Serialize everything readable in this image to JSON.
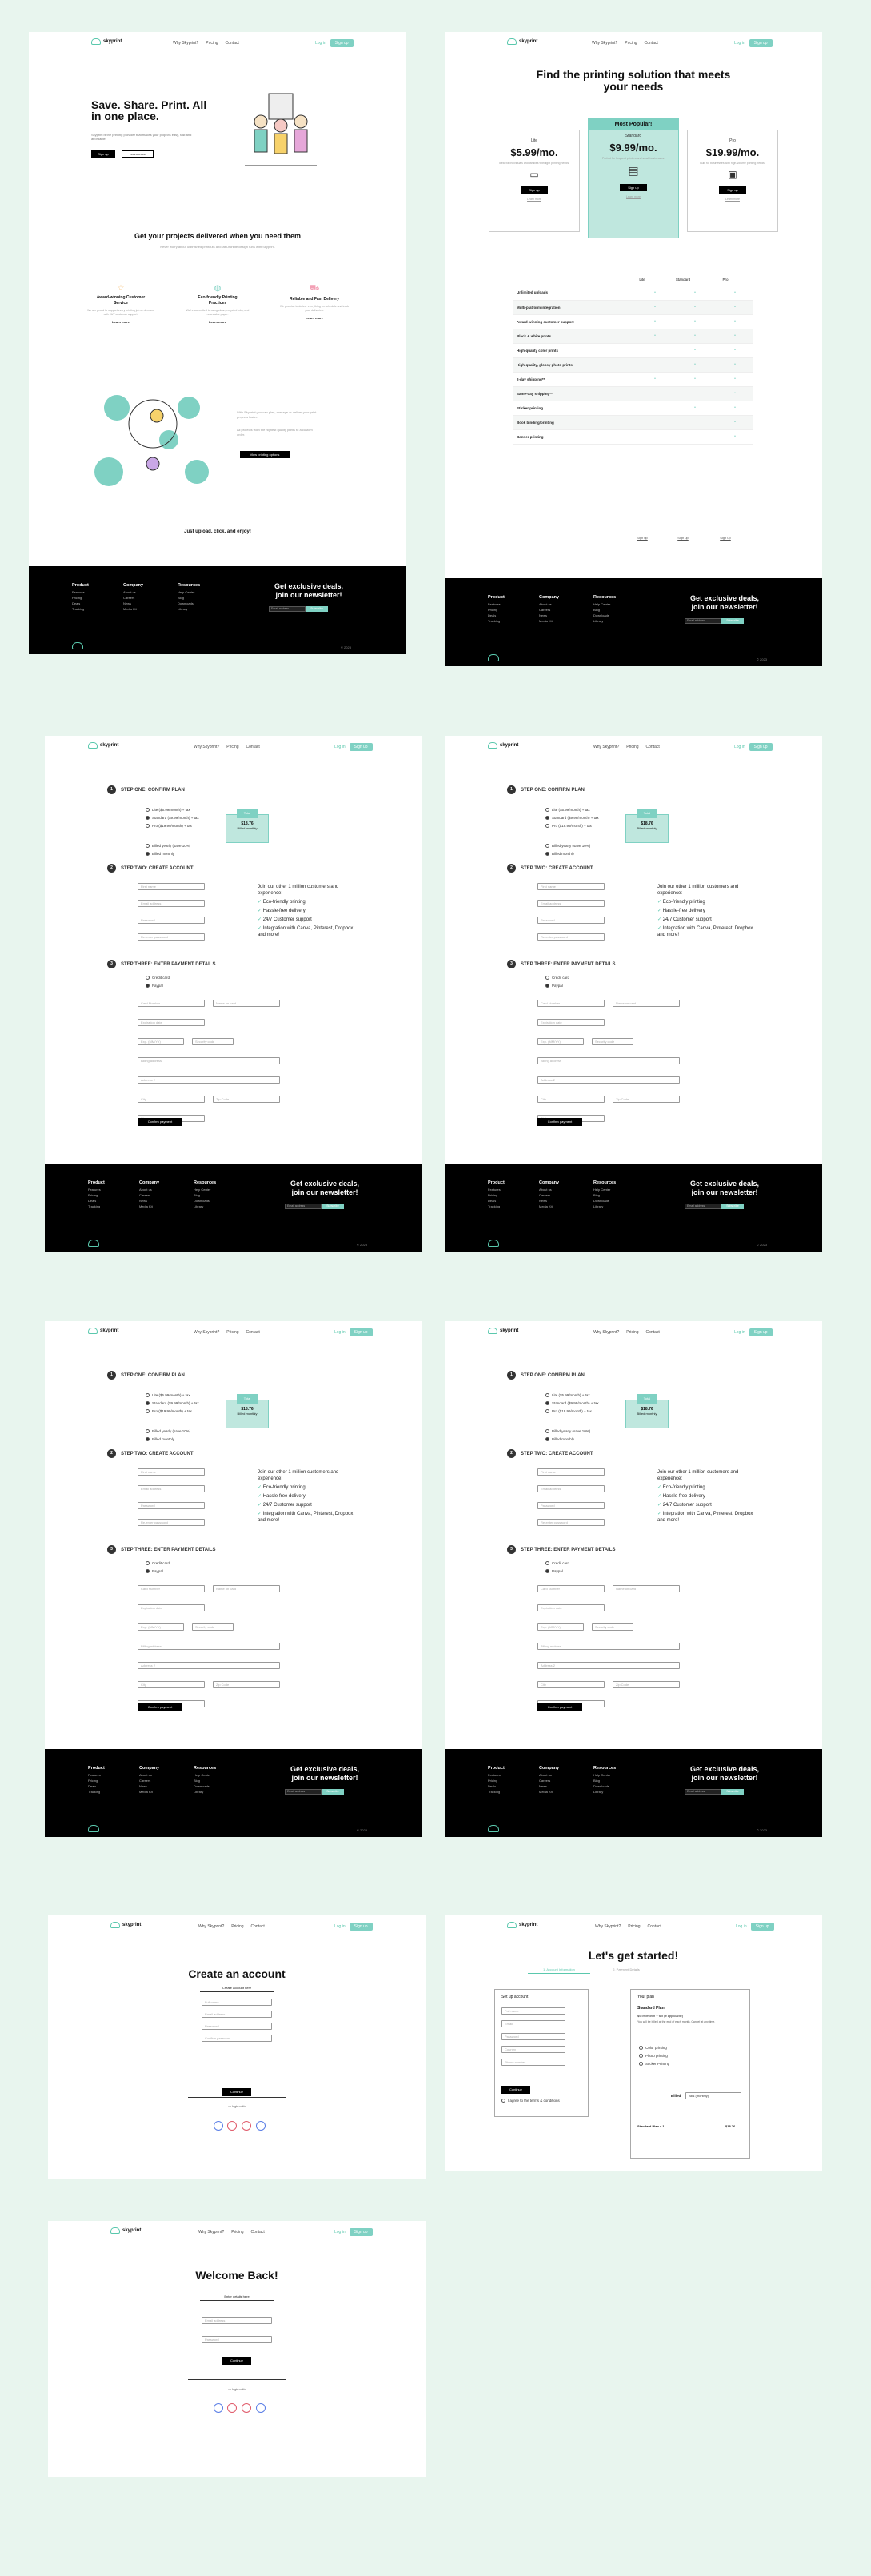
{
  "brand": "skyprint",
  "nav": {
    "why": "Why Skyprint?",
    "pricing": "Pricing",
    "contact": "Contact",
    "login": "Log in",
    "signup": "Sign up"
  },
  "footer": {
    "product": {
      "title": "Product",
      "items": [
        "Features",
        "Pricing",
        "Deals",
        "Tracking"
      ]
    },
    "company": {
      "title": "Company",
      "items": [
        "About us",
        "Careers",
        "News",
        "Media Kit"
      ]
    },
    "resources": {
      "title": "Resources",
      "items": [
        "Help Center",
        "Blog",
        "Downloads",
        "Library"
      ]
    },
    "newsletter_title": "Get exclusive deals, join our newsletter!",
    "email_placeholder": "Email address",
    "subscribe": "Subscribe",
    "copyright": "© 2023"
  },
  "home": {
    "hero_title": "Save. Share. Print. All in one place.",
    "hero_sub": "Skyprint is the printing provider that makes your projects easy, fast and affordable.",
    "signup_btn": "Sign up",
    "learn_btn": "Learn more",
    "section_title": "Get your projects delivered when you need them",
    "section_sub": "Never worry about unfinished printouts and last-minute design runs with Skyprint.",
    "features": [
      {
        "title": "Award-winning Customer Service",
        "body": "We are proud to support every printing job on demand with 24/7 customer support.",
        "link": "Learn more"
      },
      {
        "title": "Eco-friendly Printing Practices",
        "body": "We're committed to using clean, recycled inks, and renewable paper.",
        "link": "Learn more"
      },
      {
        "title": "Reliable and Fast Delivery",
        "body": "We promise to deliver everything on schedule and track your deliveries.",
        "link": "Learn more"
      }
    ],
    "info1": "With Skyprint you can plan, manage or deliver your print projects faster.",
    "info2": "All projects from the highest quality prints to a custom order.",
    "pricing_btn": "View printing options",
    "tagline": "Just upload, click, and enjoy!"
  },
  "pricing": {
    "title": "Find the printing solution that meets your needs",
    "popular": "Most Popular!",
    "plans": [
      {
        "name": "Lite",
        "price": "$5.99/mo.",
        "desc": "Ideal for individuals and families with light printing needs.",
        "btn": "Sign up",
        "link": "Learn more"
      },
      {
        "name": "Standard",
        "price": "$9.99/mo.",
        "desc": "Perfect for frequent printers and small businesses.",
        "btn": "Sign up",
        "link": "Learn more"
      },
      {
        "name": "Pro",
        "price": "$19.99/mo.",
        "desc": "Built for businesses with high-volume printing needs.",
        "btn": "Sign up",
        "link": "Learn more"
      }
    ],
    "cols": [
      "Lite",
      "Standard",
      "Pro"
    ],
    "rows": [
      {
        "label": "Unlimited uploads",
        "v": [
          "•",
          "•",
          "•"
        ]
      },
      {
        "label": "Multi-platform integration",
        "v": [
          "•",
          "•",
          "•"
        ]
      },
      {
        "label": "Award-winning customer support",
        "v": [
          "•",
          "•",
          "•"
        ]
      },
      {
        "label": "Black & white prints",
        "v": [
          "•",
          "•",
          "•"
        ]
      },
      {
        "label": "High-quality color prints",
        "v": [
          "",
          "•",
          "•"
        ]
      },
      {
        "label": "High-quality, glossy photo prints",
        "v": [
          "",
          "•",
          "•"
        ]
      },
      {
        "label": "2-day shipping**",
        "v": [
          "•",
          "•",
          "•"
        ]
      },
      {
        "label": "Same-day shipping**",
        "v": [
          "",
          "",
          "•"
        ]
      },
      {
        "label": "Sticker printing",
        "v": [
          "",
          "•",
          "•"
        ]
      },
      {
        "label": "Book binding/printing",
        "v": [
          "",
          "",
          "•"
        ]
      },
      {
        "label": "Banner printing",
        "v": [
          "",
          "",
          "•"
        ]
      }
    ],
    "signup": "Sign up"
  },
  "checkout": {
    "step1": "STEP ONE: CONFIRM PLAN",
    "step2": "STEP TWO: CREATE ACCOUNT",
    "step3": "STEP THREE: ENTER PAYMENT DETAILS",
    "plans": [
      "Lite ($5.99/month) + tax",
      "Standard ($9.99/month) + tax",
      "Pro ($19.99/month) + tax"
    ],
    "billing": [
      "Billed yearly (save 10%)",
      "Billed monthly"
    ],
    "plan_head": "Total",
    "plan_price": "$18.76",
    "plan_note": "Billed monthly",
    "fields2": [
      "First name",
      "Email address",
      "Password",
      "Re-enter password"
    ],
    "benefits_title": "Join our other 1 million customers and experience:",
    "benefits": [
      "Eco-friendly printing",
      "Hassle-free delivery",
      "24/7 Customer support",
      "Integration with Canva, Pinterest, Dropbox and more!"
    ],
    "pay_options": [
      "Credit card",
      "Paypal"
    ],
    "fields3": [
      "Card Number",
      "Name on card",
      "Expiration date",
      "Exp. (MM/YY)",
      "Security code",
      "Billing address",
      "Address 2",
      "City",
      "Zip Code",
      "State"
    ],
    "confirm": "Confirm payment"
  },
  "create": {
    "title": "Create an account",
    "sub": "Create account here",
    "fields": [
      "Full name",
      "Email address",
      "Password",
      "Confirm password"
    ],
    "btn": "Continue",
    "or": "or login with"
  },
  "started": {
    "title": "Let's get started!",
    "tabs": [
      "1. Account Information",
      "2. Payment Details"
    ],
    "setup": "Set up account",
    "fields": [
      "Full name",
      "Email",
      "Password",
      "Country",
      "Phone number"
    ],
    "continue": "Continue",
    "agree": "I agree to the terms & conditions",
    "yourplan": "Your plan",
    "planname": "Standard Plan",
    "planprice": "$9.99/month + tax (if applicable)",
    "plandesc": "You will be billed at the end of each month. Cancel at any time.",
    "includes": [
      "Color printing",
      "Photo printing",
      "Sticker Printing"
    ],
    "billed": "Billed",
    "select": "Bills (monthly)",
    "total_label": "Standard Plan x 1",
    "total": "$18.76"
  },
  "welcome": {
    "title": "Welcome Back!",
    "sub": "Enter details here",
    "fields": [
      "Email address",
      "Password"
    ],
    "btn": "Continue",
    "or": "or login with"
  }
}
